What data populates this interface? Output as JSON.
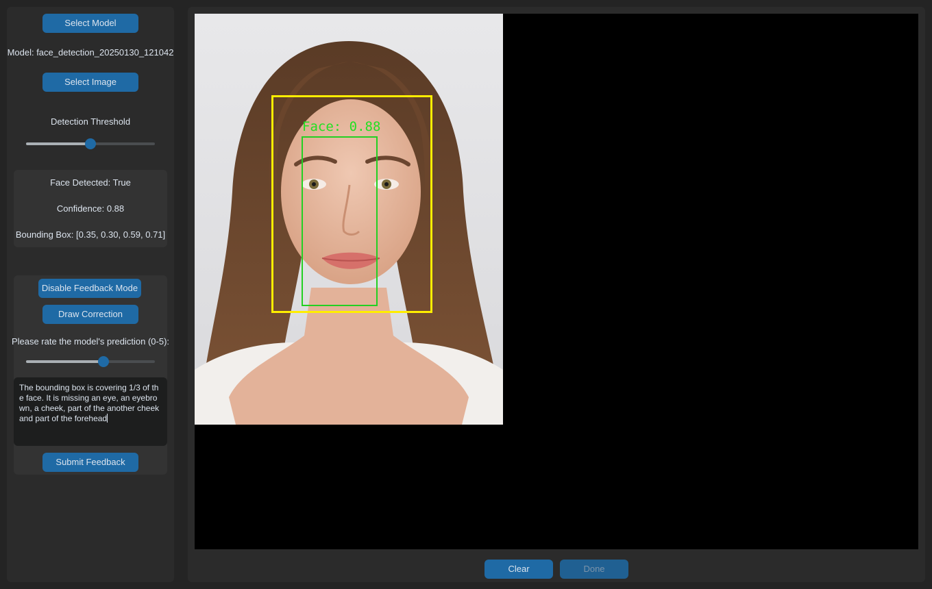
{
  "sidebar": {
    "select_model_label": "Select Model",
    "model_text": "Model: face_detection_20250130_121042",
    "select_image_label": "Select Image",
    "threshold_label": "Detection Threshold",
    "threshold_value": 0.5,
    "results": {
      "face_detected": "Face Detected: True",
      "confidence": "Confidence: 0.88",
      "bounding_box": "Bounding Box: [0.35, 0.30, 0.59, 0.71]"
    },
    "feedback": {
      "disable_mode_label": "Disable Feedback Mode",
      "draw_correction_label": "Draw Correction",
      "rating_prompt": "Please rate the model's prediction (0-5):",
      "rating_value": 3,
      "rating_max": 5,
      "comment_text": "The bounding box is covering 1/3 of the face. It is missing an eye, an eyebrown, a cheek, part of the another cheek and part of the forehead",
      "submit_label": "Submit Feedback"
    }
  },
  "canvas": {
    "detection_label": "Face: 0.88",
    "prediction_box_color": "#ffee00",
    "correction_box_color": "#22d022"
  },
  "footer": {
    "clear_label": "Clear",
    "done_label": "Done"
  },
  "colors": {
    "accent": "#1f6aa5",
    "panel_bg": "#2b2b2b",
    "window_bg": "#242424"
  }
}
